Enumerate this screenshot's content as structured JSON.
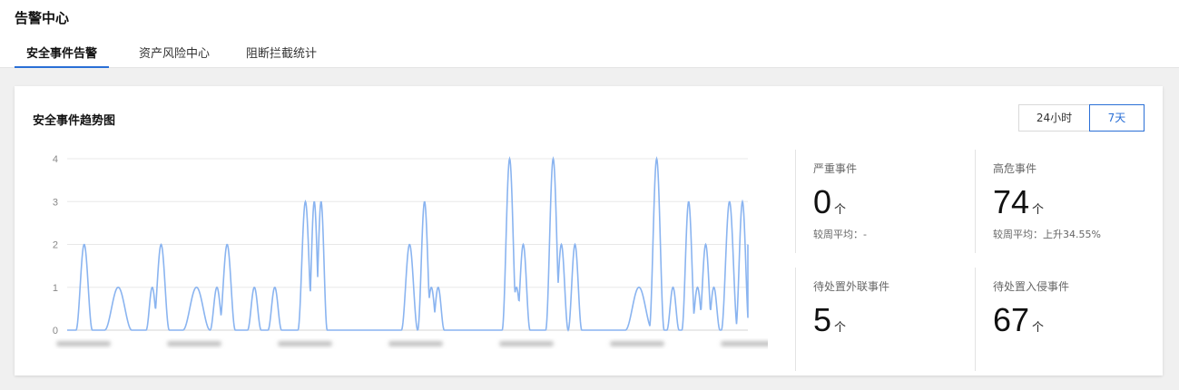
{
  "header": {
    "title": "告警中心",
    "tabs": [
      {
        "label": "安全事件告警",
        "active": true
      },
      {
        "label": "资产风险中心",
        "active": false
      },
      {
        "label": "阻断拦截统计",
        "active": false
      }
    ]
  },
  "card": {
    "title": "安全事件趋势图",
    "range_options": [
      {
        "label": "24小时",
        "selected": false
      },
      {
        "label": "7天",
        "selected": true
      }
    ]
  },
  "stats": [
    {
      "label": "严重事件",
      "value": "0",
      "unit": "个",
      "compare": "较周平均：-"
    },
    {
      "label": "高危事件",
      "value": "74",
      "unit": "个",
      "compare": "较周平均：上升34.55%"
    },
    {
      "label": "待处置外联事件",
      "value": "5",
      "unit": "个",
      "compare": ""
    },
    {
      "label": "待处置入侵事件",
      "value": "67",
      "unit": "个",
      "compare": ""
    }
  ],
  "colors": {
    "accent": "#2a6fd6",
    "line": "#8ab4f0",
    "grid": "#e8e8e8"
  },
  "chart_data": {
    "type": "line",
    "ylim": [
      0,
      4
    ],
    "yticks": [
      0,
      1,
      2,
      3,
      4
    ],
    "grid": true,
    "x_labels_blurred": true,
    "peaks": [
      {
        "t": 2.5,
        "v": 2,
        "w": 1.2
      },
      {
        "t": 7.5,
        "v": 1,
        "w": 2.0
      },
      {
        "t": 12.5,
        "v": 1,
        "w": 0.9
      },
      {
        "t": 13.8,
        "v": 2,
        "w": 1.2
      },
      {
        "t": 19.0,
        "v": 1,
        "w": 2.0
      },
      {
        "t": 22.0,
        "v": 1,
        "w": 1.0
      },
      {
        "t": 23.5,
        "v": 2,
        "w": 1.2
      },
      {
        "t": 27.5,
        "v": 1,
        "w": 1.0
      },
      {
        "t": 30.5,
        "v": 1,
        "w": 1.0
      },
      {
        "t": 35.0,
        "v": 3,
        "w": 1.1
      },
      {
        "t": 36.3,
        "v": 3,
        "w": 0.9
      },
      {
        "t": 37.3,
        "v": 3,
        "w": 0.9
      },
      {
        "t": 50.3,
        "v": 2,
        "w": 1.2
      },
      {
        "t": 52.5,
        "v": 3,
        "w": 1.0
      },
      {
        "t": 53.5,
        "v": 1,
        "w": 0.9
      },
      {
        "t": 54.5,
        "v": 1,
        "w": 0.9
      },
      {
        "t": 65.0,
        "v": 4,
        "w": 1.1
      },
      {
        "t": 66.0,
        "v": 1,
        "w": 0.9
      },
      {
        "t": 67.0,
        "v": 2,
        "w": 1.0
      },
      {
        "t": 71.4,
        "v": 4,
        "w": 1.1
      },
      {
        "t": 72.6,
        "v": 2,
        "w": 1.0
      },
      {
        "t": 74.6,
        "v": 2,
        "w": 1.0
      },
      {
        "t": 84.0,
        "v": 1,
        "w": 2.0
      },
      {
        "t": 86.6,
        "v": 4,
        "w": 1.1
      },
      {
        "t": 89.0,
        "v": 1,
        "w": 0.9
      },
      {
        "t": 91.3,
        "v": 3,
        "w": 1.0
      },
      {
        "t": 92.6,
        "v": 1,
        "w": 0.9
      },
      {
        "t": 93.8,
        "v": 2,
        "w": 1.0
      },
      {
        "t": 95.0,
        "v": 1,
        "w": 0.9
      },
      {
        "t": 97.3,
        "v": 3,
        "w": 1.2
      },
      {
        "t": 99.2,
        "v": 3,
        "w": 1.0
      }
    ],
    "x_extent": [
      0,
      100
    ]
  }
}
